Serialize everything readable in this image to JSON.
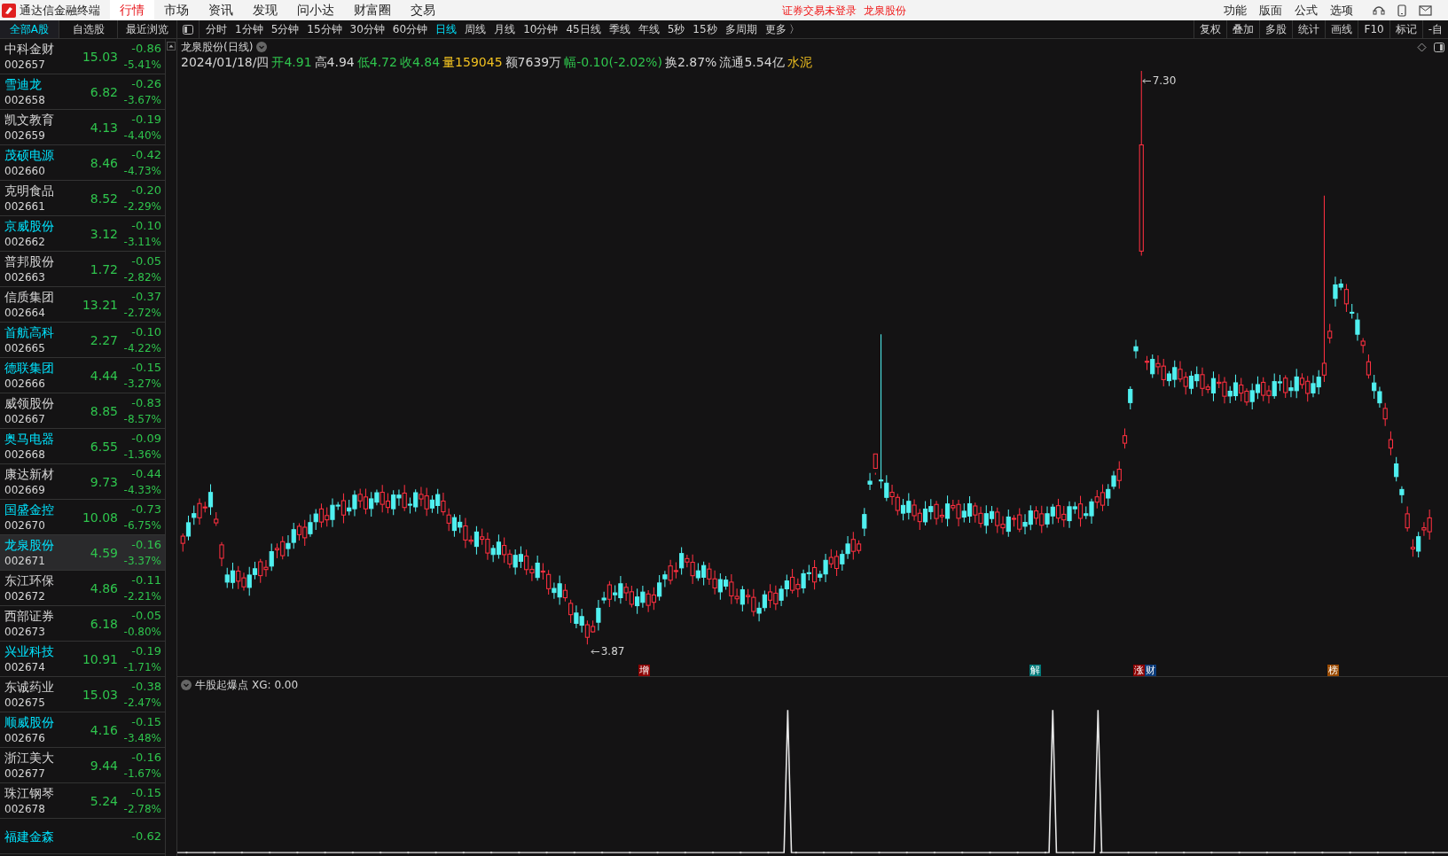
{
  "app": {
    "title": "通达信金融终端"
  },
  "nav_tabs": [
    {
      "label": "行情",
      "selected": true
    },
    {
      "label": "市场",
      "selected": false
    },
    {
      "label": "资讯",
      "selected": false
    },
    {
      "label": "发现",
      "selected": false
    },
    {
      "label": "问小达",
      "selected": false
    },
    {
      "label": "财富圈",
      "selected": false
    },
    {
      "label": "交易",
      "selected": false
    }
  ],
  "notice": [
    "证券交易未登录",
    "龙泉股份"
  ],
  "top_menu": [
    "功能",
    "版面",
    "公式",
    "选项"
  ],
  "list_tabs": [
    {
      "label": "全部A股",
      "selected": true
    },
    {
      "label": "自选股",
      "selected": false
    },
    {
      "label": "最近浏览",
      "selected": false
    }
  ],
  "periods": [
    {
      "label": "分时",
      "selected": false
    },
    {
      "label": "1分钟",
      "selected": false
    },
    {
      "label": "5分钟",
      "selected": false
    },
    {
      "label": "15分钟",
      "selected": false
    },
    {
      "label": "30分钟",
      "selected": false
    },
    {
      "label": "60分钟",
      "selected": false
    },
    {
      "label": "日线",
      "selected": true
    },
    {
      "label": "周线",
      "selected": false
    },
    {
      "label": "月线",
      "selected": false
    },
    {
      "label": "10分钟",
      "selected": false
    },
    {
      "label": "45日线",
      "selected": false
    },
    {
      "label": "季线",
      "selected": false
    },
    {
      "label": "年线",
      "selected": false
    },
    {
      "label": "5秒",
      "selected": false
    },
    {
      "label": "15秒",
      "selected": false
    },
    {
      "label": "多周期",
      "selected": false
    },
    {
      "label": "更多 〉",
      "selected": false
    }
  ],
  "tools": [
    "复权",
    "叠加",
    "多股",
    "统计",
    "画线",
    "F10",
    "标记",
    "-自"
  ],
  "stocks": [
    {
      "name": "中科金财",
      "code": "002657",
      "price": "15.03",
      "change": "-0.86",
      "change_pct": "-5.41%",
      "color": "#d6d6d6",
      "selected": false
    },
    {
      "name": "雪迪龙",
      "code": "002658",
      "price": "6.82",
      "change": "-0.26",
      "change_pct": "-3.67%",
      "color": "#00e4ff",
      "selected": false
    },
    {
      "name": "凯文教育",
      "code": "002659",
      "price": "4.13",
      "change": "-0.19",
      "change_pct": "-4.40%",
      "color": "#d6d6d6",
      "selected": false
    },
    {
      "name": "茂硕电源",
      "code": "002660",
      "price": "8.46",
      "change": "-0.42",
      "change_pct": "-4.73%",
      "color": "#00e4ff",
      "selected": false
    },
    {
      "name": "克明食品",
      "code": "002661",
      "price": "8.52",
      "change": "-0.20",
      "change_pct": "-2.29%",
      "color": "#d6d6d6",
      "selected": false
    },
    {
      "name": "京威股份",
      "code": "002662",
      "price": "3.12",
      "change": "-0.10",
      "change_pct": "-3.11%",
      "color": "#00e4ff",
      "selected": false
    },
    {
      "name": "普邦股份",
      "code": "002663",
      "price": "1.72",
      "change": "-0.05",
      "change_pct": "-2.82%",
      "color": "#d6d6d6",
      "selected": false
    },
    {
      "name": "信质集团",
      "code": "002664",
      "price": "13.21",
      "change": "-0.37",
      "change_pct": "-2.72%",
      "color": "#d6d6d6",
      "selected": false
    },
    {
      "name": "首航高科",
      "code": "002665",
      "price": "2.27",
      "change": "-0.10",
      "change_pct": "-4.22%",
      "color": "#00e4ff",
      "selected": false
    },
    {
      "name": "德联集团",
      "code": "002666",
      "price": "4.44",
      "change": "-0.15",
      "change_pct": "-3.27%",
      "color": "#00e4ff",
      "selected": false
    },
    {
      "name": "威领股份",
      "code": "002667",
      "price": "8.85",
      "change": "-0.83",
      "change_pct": "-8.57%",
      "color": "#d6d6d6",
      "selected": false
    },
    {
      "name": "奥马电器",
      "code": "002668",
      "price": "6.55",
      "change": "-0.09",
      "change_pct": "-1.36%",
      "color": "#00e4ff",
      "selected": false
    },
    {
      "name": "康达新材",
      "code": "002669",
      "price": "9.73",
      "change": "-0.44",
      "change_pct": "-4.33%",
      "color": "#d6d6d6",
      "selected": false
    },
    {
      "name": "国盛金控",
      "code": "002670",
      "price": "10.08",
      "change": "-0.73",
      "change_pct": "-6.75%",
      "color": "#00e4ff",
      "selected": false
    },
    {
      "name": "龙泉股份",
      "code": "002671",
      "price": "4.59",
      "change": "-0.16",
      "change_pct": "-3.37%",
      "color": "#00e4ff",
      "selected": true
    },
    {
      "name": "东江环保",
      "code": "002672",
      "price": "4.86",
      "change": "-0.11",
      "change_pct": "-2.21%",
      "color": "#d6d6d6",
      "selected": false
    },
    {
      "name": "西部证券",
      "code": "002673",
      "price": "6.18",
      "change": "-0.05",
      "change_pct": "-0.80%",
      "color": "#d6d6d6",
      "selected": false
    },
    {
      "name": "兴业科技",
      "code": "002674",
      "price": "10.91",
      "change": "-0.19",
      "change_pct": "-1.71%",
      "color": "#00e4ff",
      "selected": false
    },
    {
      "name": "东诚药业",
      "code": "002675",
      "price": "15.03",
      "change": "-0.38",
      "change_pct": "-2.47%",
      "color": "#d6d6d6",
      "selected": false
    },
    {
      "name": "顺威股份",
      "code": "002676",
      "price": "4.16",
      "change": "-0.15",
      "change_pct": "-3.48%",
      "color": "#00e4ff",
      "selected": false
    },
    {
      "name": "浙江美大",
      "code": "002677",
      "price": "9.44",
      "change": "-0.16",
      "change_pct": "-1.67%",
      "color": "#d6d6d6",
      "selected": false
    },
    {
      "name": "珠江钢琴",
      "code": "002678",
      "price": "5.24",
      "change": "-0.15",
      "change_pct": "-2.78%",
      "color": "#d6d6d6",
      "selected": false
    },
    {
      "name": "福建金森",
      "change": "-0.62",
      "color": "#00e4ff",
      "selected": false
    }
  ],
  "chart": {
    "title": "龙泉股份(日线)",
    "info": [
      {
        "text": "2024/01/18/四",
        "color": "#d6d6d6"
      },
      {
        "text": "开4.91",
        "color": "#2fc44d"
      },
      {
        "text": "高4.94",
        "color": "#d6d6d6"
      },
      {
        "text": "低4.72",
        "color": "#2fc44d"
      },
      {
        "text": "收4.84",
        "color": "#2fc44d"
      },
      {
        "text": "量159045",
        "color": "#f0c020"
      },
      {
        "text": "额7639万",
        "color": "#d6d6d6"
      },
      {
        "text": "幅-0.10(-2.02%)",
        "color": "#2fc44d"
      },
      {
        "text": "换2.87%",
        "color": "#d6d6d6"
      },
      {
        "text": "流通5.54亿",
        "color": "#d6d6d6"
      },
      {
        "text": "水泥",
        "color": "#f0c020"
      }
    ],
    "high_label": "7.30",
    "low_label": "3.87",
    "markers": [
      {
        "text": "增",
        "color": "#8b0000"
      },
      {
        "text": "解",
        "color": "#007a7a"
      },
      {
        "text": "涨",
        "color": "#8b0000"
      },
      {
        "text": "财",
        "color": "#0a3a78"
      },
      {
        "text": "榜",
        "color": "#9a4a00"
      }
    ]
  },
  "indicator": {
    "title": "牛股起爆点",
    "reading": "XG: 0.00"
  }
}
